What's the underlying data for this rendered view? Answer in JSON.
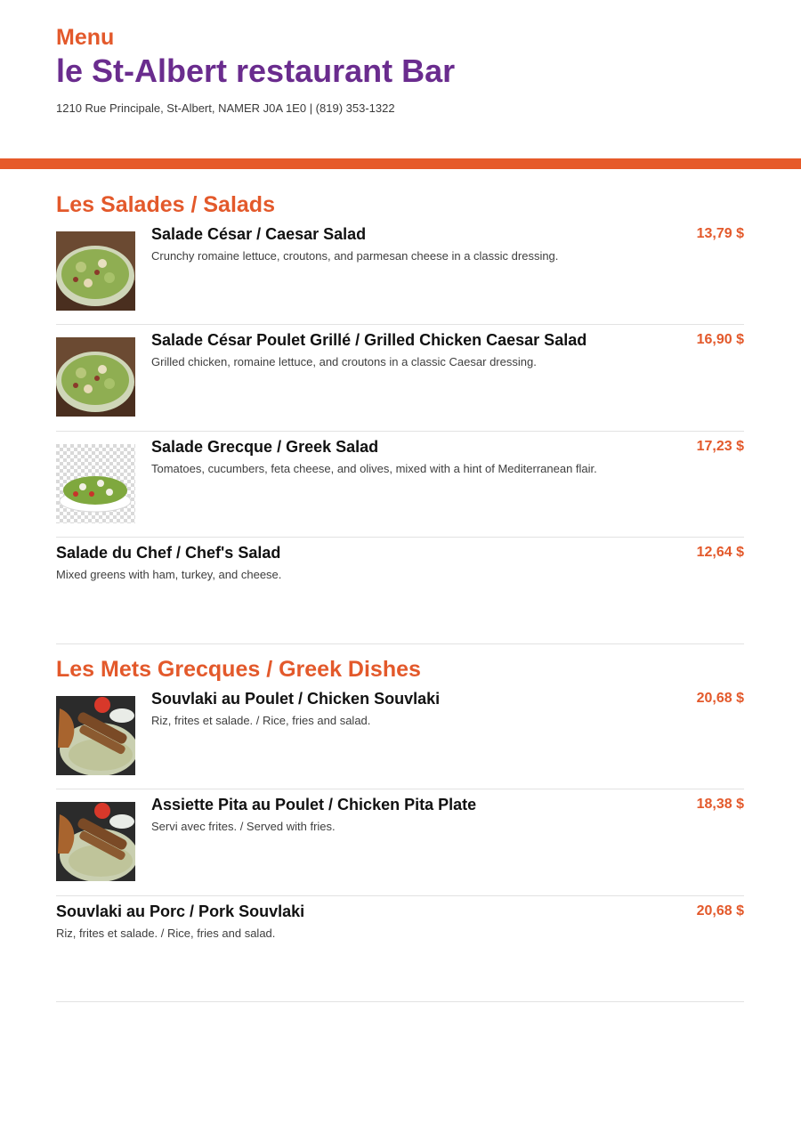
{
  "header": {
    "menu_label": "Menu",
    "restaurant_name": "le St-Albert restaurant Bar",
    "address": "1210 Rue Principale, St-Albert, NAMER J0A 1E0 | (819) 353-1322"
  },
  "sections": [
    {
      "title": "Les Salades / Salads",
      "items": [
        {
          "name": "Salade César / Caesar Salad",
          "description": "Crunchy romaine lettuce, croutons, and parmesan cheese in a classic dressing.",
          "price": "13,79 $",
          "image": "caesar-salad-photo"
        },
        {
          "name": "Salade César Poulet Grillé / Grilled Chicken Caesar Salad",
          "description": "Grilled chicken, romaine lettuce, and croutons in a classic Caesar dressing.",
          "price": "16,90 $",
          "image": "chicken-caesar-salad-photo"
        },
        {
          "name": "Salade Grecque / Greek Salad",
          "description": "Tomatoes, cucumbers, feta cheese, and olives, mixed with a hint of Mediterranean flair.",
          "price": "17,23 $",
          "image": "greek-salad-photo"
        },
        {
          "name": "Salade du Chef / Chef's Salad",
          "description": "Mixed greens with ham, turkey, and cheese.",
          "price": "12,64 $"
        }
      ]
    },
    {
      "title": "Les Mets Grecques / Greek Dishes",
      "items": [
        {
          "name": "Souvlaki au Poulet / Chicken Souvlaki",
          "description": "Riz, frites et salade. / Rice, fries and salad.",
          "price": "20,68 $",
          "image": "chicken-souvlaki-photo"
        },
        {
          "name": "Assiette Pita au Poulet / Chicken Pita Plate",
          "description": "Servi avec frites. / Served with fries.",
          "price": "18,38 $",
          "image": "chicken-pita-plate-photo"
        },
        {
          "name": "Souvlaki au Porc / Pork Souvlaki",
          "description": "Riz, frites et salade. / Rice, fries and salad.",
          "price": "20,68 $"
        }
      ]
    }
  ],
  "colors": {
    "accent": "#e3592b",
    "brand": "#6a2c8e"
  }
}
